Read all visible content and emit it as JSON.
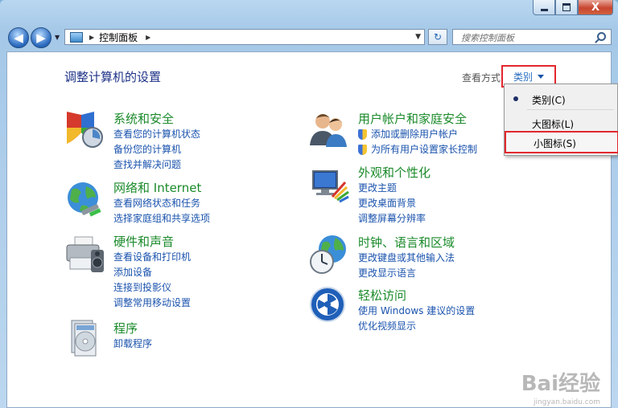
{
  "window": {
    "close_glyph": "X"
  },
  "nav": {
    "back_glyph": "◀",
    "forward_glyph": "▶",
    "address_text": "控制面板",
    "refresh_glyph": "↻",
    "search_placeholder": "搜索控制面板"
  },
  "heading": "调整计算机的设置",
  "view_by": {
    "label": "查看方式:",
    "value": "类别"
  },
  "menu": {
    "items": [
      {
        "label": "类别(C)",
        "selected": true
      },
      {
        "label": "大图标(L)",
        "selected": false
      },
      {
        "label": "小图标(S)",
        "selected": false,
        "highlighted": true
      }
    ]
  },
  "categories": [
    {
      "title": "系统和安全",
      "icon": "system-security-icon",
      "links": [
        "查看您的计算机状态",
        "备份您的计算机",
        "查找并解决问题"
      ]
    },
    {
      "title": "网络和 Internet",
      "icon": "network-icon",
      "links": [
        "查看网络状态和任务",
        "选择家庭组和共享选项"
      ]
    },
    {
      "title": "硬件和声音",
      "icon": "hardware-sound-icon",
      "links": [
        "查看设备和打印机",
        "添加设备",
        "连接到投影仪",
        "调整常用移动设置"
      ]
    },
    {
      "title": "程序",
      "icon": "programs-icon",
      "links": [
        "卸载程序"
      ]
    },
    {
      "title": "用户帐户和家庭安全",
      "icon": "user-accounts-icon",
      "links": [
        "添加或删除用户帐户",
        "为所有用户设置家长控制"
      ]
    },
    {
      "title": "外观和个性化",
      "icon": "appearance-icon",
      "links": [
        "更改主题",
        "更改桌面背景",
        "调整屏幕分辨率"
      ]
    },
    {
      "title": "时钟、语言和区域",
      "icon": "clock-language-icon",
      "links": [
        "更改键盘或其他输入法",
        "更改显示语言"
      ]
    },
    {
      "title": "轻松访问",
      "icon": "ease-of-access-icon",
      "links": [
        "使用 Windows 建议的设置",
        "优化视频显示"
      ]
    }
  ],
  "watermark": {
    "text": "Bai经验",
    "url": "jingyan.baidu.com"
  }
}
